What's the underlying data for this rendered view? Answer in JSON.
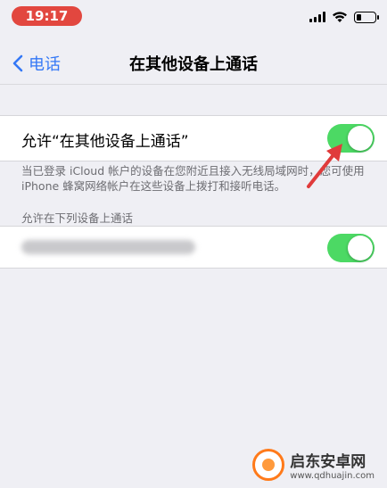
{
  "status_bar": {
    "time": "19:17"
  },
  "nav": {
    "back_label": "电话",
    "title": "在其他设备上通话"
  },
  "allow_calls": {
    "label": "允许“在其他设备上通话”",
    "toggle_on": true,
    "footnote": "当已登录 iCloud 帐户的设备在您附近且接入无线局域网时，您可使用 iPhone 蜂窝网络帐户在这些设备上拨打和接听电话。"
  },
  "devices": {
    "header": "允许在下列设备上通话",
    "items": [
      {
        "toggle_on": true
      }
    ]
  },
  "watermark": {
    "name": "启东安卓网",
    "url": "www.qdhuajin.com"
  },
  "colors": {
    "accent": "#3478f6",
    "toggle_on": "#4cd964",
    "time_pill": "#e2473f",
    "arrow": "#e03b3b"
  }
}
